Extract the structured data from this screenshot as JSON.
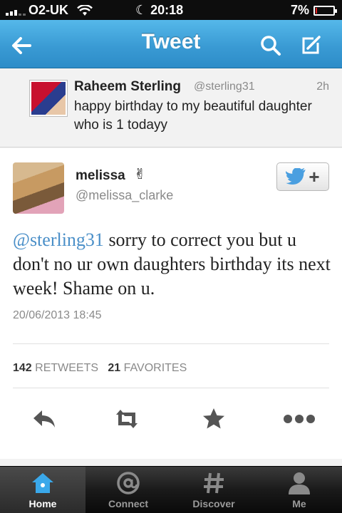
{
  "status_bar": {
    "carrier": "O2-UK",
    "time": "20:18",
    "battery": "7%",
    "battery_level": 0.07
  },
  "nav": {
    "title": "Tweet",
    "back_icon": "back-arrow-icon",
    "search_icon": "search-icon",
    "compose_icon": "compose-icon"
  },
  "quoted_tweet": {
    "name": "Raheem Sterling",
    "handle": "@sterling31",
    "age": "2h",
    "text": "happy birthday to my beautiful daughter who is 1 todayy"
  },
  "tweet": {
    "name": "melissa",
    "name_emoji": "✌",
    "handle": "@melissa_clarke",
    "mention": "@sterling31",
    "text": " sorry to correct you but u don't no ur own daughters birthday its next week! Shame on u.",
    "date": "20/06/2013 18:45",
    "retweets_count": "142",
    "retweets_label": "RETWEETS",
    "favorites_count": "21",
    "favorites_label": "FAVORITES",
    "follow_plus": "+"
  },
  "tabs": [
    {
      "label": "Home",
      "icon": "home-icon",
      "active": true
    },
    {
      "label": "Connect",
      "icon": "at-icon",
      "active": false
    },
    {
      "label": "Discover",
      "icon": "hash-icon",
      "active": false
    },
    {
      "label": "Me",
      "icon": "person-icon",
      "active": false
    }
  ],
  "colors": {
    "nav_blue": "#3a9bd4",
    "link_blue": "#4a8fc8",
    "tab_active_icon": "#3aa8ea"
  }
}
